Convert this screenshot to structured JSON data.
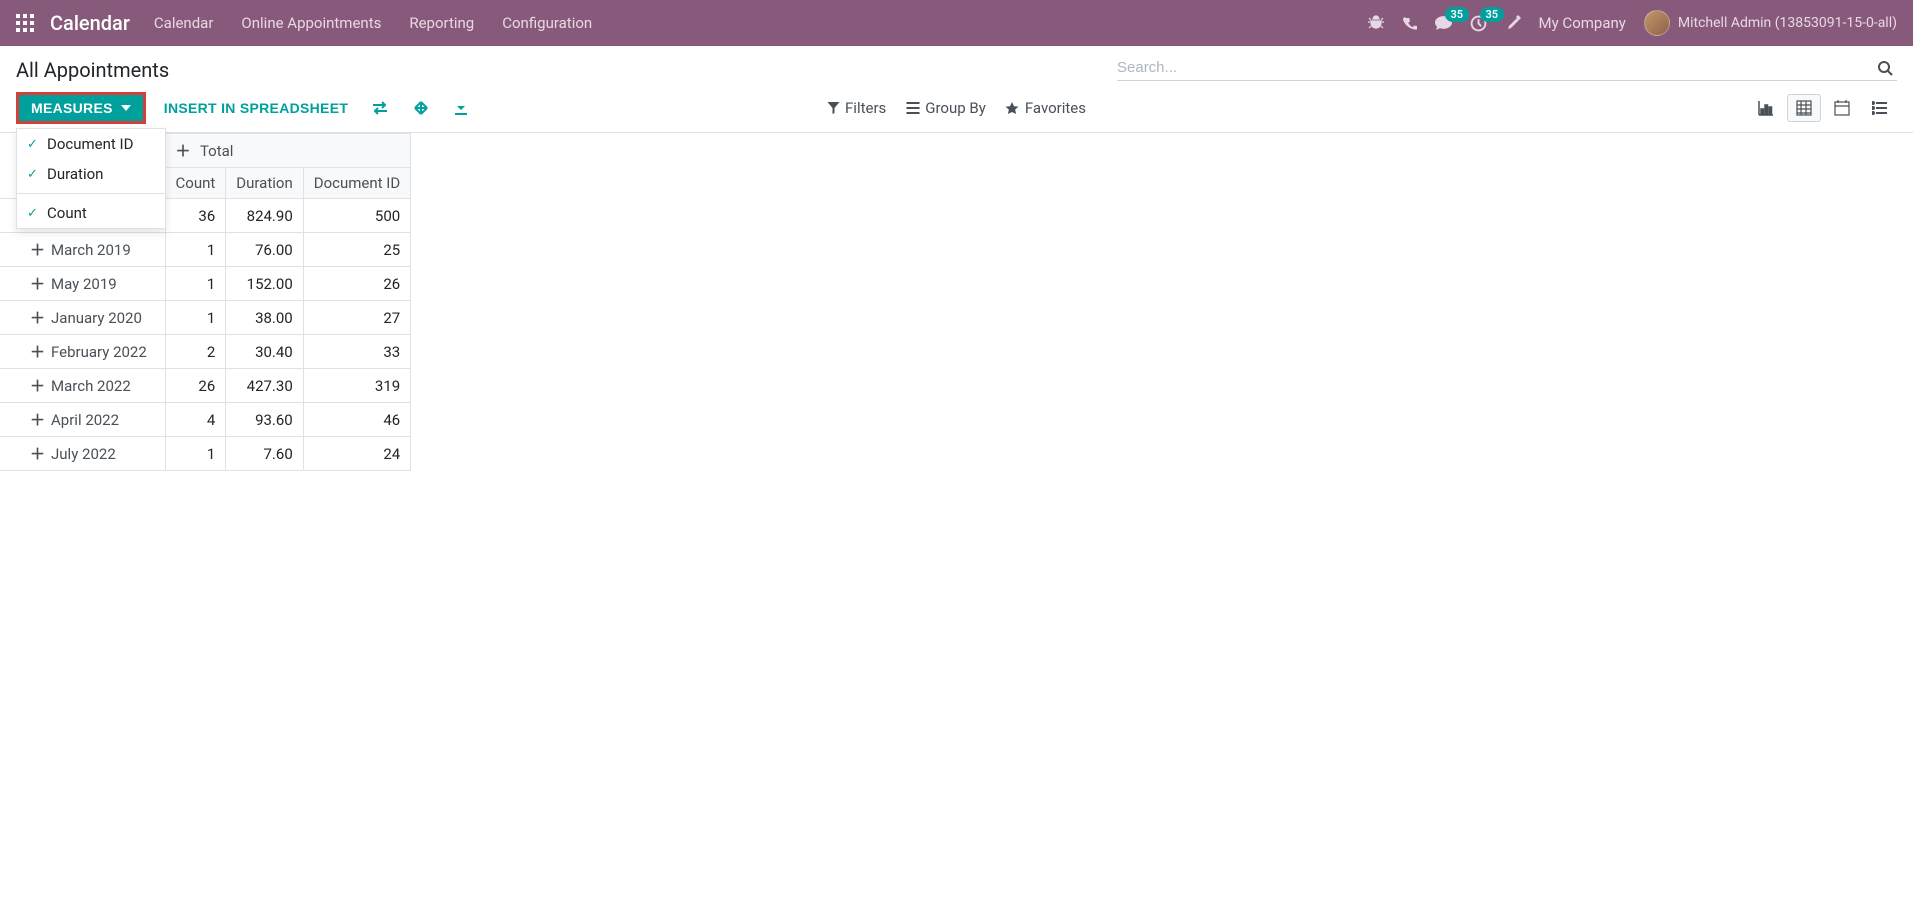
{
  "navbar": {
    "brand": "Calendar",
    "menu": [
      "Calendar",
      "Online Appointments",
      "Reporting",
      "Configuration"
    ],
    "badges": {
      "messages": "35",
      "activities": "35"
    },
    "company": "My Company",
    "user": "Mitchell Admin (13853091-15-0-all)"
  },
  "controlPanel": {
    "breadcrumb": "All Appointments",
    "searchPlaceholder": "Search...",
    "measuresLabel": "MEASURES",
    "insertLabel": "INSERT IN SPREADSHEET",
    "filters": "Filters",
    "groupBy": "Group By",
    "favorites": "Favorites"
  },
  "measuresDropdown": {
    "items": [
      {
        "label": "Document ID",
        "checked": true
      },
      {
        "label": "Duration",
        "checked": true
      }
    ],
    "countLabel": "Count",
    "countChecked": true
  },
  "pivot": {
    "totalLabel": "Total",
    "columns": [
      "Count",
      "Duration",
      "Document ID"
    ],
    "totalRow": {
      "label": "Total",
      "count": "36",
      "duration": "824.90",
      "docId": "500"
    },
    "rows": [
      {
        "label": "March 2019",
        "count": "1",
        "duration": "76.00",
        "docId": "25"
      },
      {
        "label": "May 2019",
        "count": "1",
        "duration": "152.00",
        "docId": "26"
      },
      {
        "label": "January 2020",
        "count": "1",
        "duration": "38.00",
        "docId": "27"
      },
      {
        "label": "February 2022",
        "count": "2",
        "duration": "30.40",
        "docId": "33"
      },
      {
        "label": "March 2022",
        "count": "26",
        "duration": "427.30",
        "docId": "319"
      },
      {
        "label": "April 2022",
        "count": "4",
        "duration": "93.60",
        "docId": "46"
      },
      {
        "label": "July 2022",
        "count": "1",
        "duration": "7.60",
        "docId": "24"
      }
    ]
  }
}
